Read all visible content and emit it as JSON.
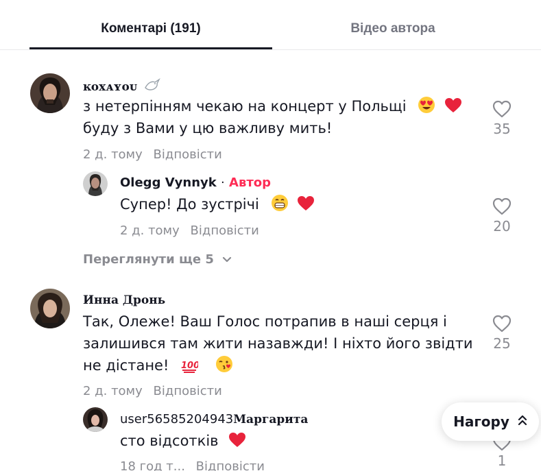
{
  "tabs": {
    "comments_label": "Коментарі (191)",
    "creator_videos_label": "Відео автора"
  },
  "comments": [
    {
      "username": "ĸᴏxᴀʏᴏᴜ",
      "text_line1": "з нетерпінням чекаю на концерт у Польщі",
      "text_line2": "буду з Вами у цю важливу мить!",
      "time": "2 д. тому",
      "reply_label": "Відповісти",
      "likes": "35"
    },
    {
      "username": "Olegg Vynnyk",
      "separator": "·",
      "author_badge": "Автор",
      "text_line1": "Супер! До зустрічі",
      "time": "2 д. тому",
      "reply_label": "Відповісти",
      "likes": "20"
    },
    {
      "view_more_label": "Переглянути ще 5"
    },
    {
      "username": "Инна Дронь",
      "text_line1": "Так, Олеже! Ваш Голос потрапив в наші серця і",
      "text_line2": "залишився там жити назавжди! І ніхто його звідти",
      "text_line3": "не дістане!",
      "time": "2 д. тому",
      "reply_label": "Відповісти",
      "likes": "25"
    },
    {
      "username_prefix": "user56585204943",
      "username_suffix": "Маргарита",
      "text_line1": "сто відсотків",
      "time": "18 год т...",
      "reply_label": "Відповісти",
      "likes": "1"
    }
  ],
  "back_to_top": {
    "label": "Нагору"
  },
  "colors": {
    "text": "#161823",
    "muted": "#8a8b91",
    "author": "#fe2c55",
    "heart_red": "#e8233b"
  }
}
